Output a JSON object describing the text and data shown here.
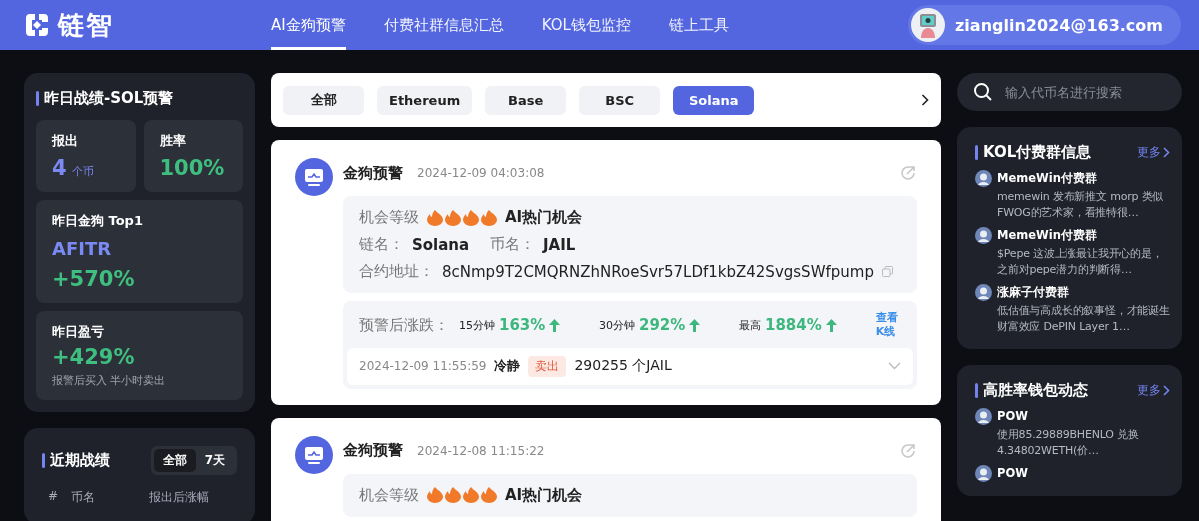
{
  "header": {
    "logo": "链智",
    "nav": [
      {
        "label": "AI金狗预警",
        "selected": true
      },
      {
        "label": "付费社群信息汇总",
        "selected": false
      },
      {
        "label": "KOL钱包监控",
        "selected": false
      },
      {
        "label": "链上工具",
        "selected": false
      }
    ],
    "user": {
      "email": "zianglin2024@163.com"
    }
  },
  "summary": {
    "title": "昨日战绩-SOL预警",
    "reported_label": "报出",
    "reported": "4",
    "reported_unit": "个币",
    "winrate_label": "胜率",
    "winrate": "100%",
    "top_label": "昨日金狗 Top1",
    "top_token": "AFITR",
    "top_gain": "+570%",
    "pnl_label": "昨日盈亏",
    "pnl": "+429%",
    "pnl_note": "报警后买入 半小时卖出"
  },
  "recent": {
    "title": "近期战绩",
    "periods": [
      {
        "label": "全部",
        "selected": true
      },
      {
        "label": "7天",
        "selected": false
      }
    ],
    "columns": [
      "#",
      "币名",
      "报出后涨幅"
    ]
  },
  "filters": [
    {
      "label": "全部",
      "selected": false
    },
    {
      "label": "Ethereum",
      "selected": false
    },
    {
      "label": "Base",
      "selected": false
    },
    {
      "label": "BSC",
      "selected": false
    },
    {
      "label": "Solana",
      "selected": true
    }
  ],
  "alerts": [
    {
      "title": "金狗预警",
      "time": "2024-12-09 04:03:08",
      "level_label": "机会等级",
      "stars": 4,
      "opportunity": "AI热门机会",
      "chain_label": "链名：",
      "chain": "Solana",
      "token_label": "币名：",
      "token": "JAIL",
      "contract_label": "合约地址：",
      "contract": "8cNmp9T2CMQRNZhNRoeSvr57LDf1kbZ42SvgsSWfpump",
      "change_label": "预警后涨跌：",
      "changes": [
        {
          "period": "15分钟",
          "value": "163%"
        },
        {
          "period": "30分钟",
          "value": "292%"
        },
        {
          "period": "最高",
          "value": "1884%"
        }
      ],
      "kline": "查看K线",
      "trade": {
        "time": "2024-12-09 11:55:59",
        "mood": "冷静",
        "action": "卖出",
        "amount": "290255 个JAIL"
      }
    },
    {
      "title": "金狗预警",
      "time": "2024-12-08 11:15:22",
      "level_label": "机会等级",
      "stars": 4,
      "opportunity": "AI热门机会"
    }
  ],
  "search": {
    "placeholder": "输入代币名进行搜索"
  },
  "kol": {
    "title": "KOL付费群信息",
    "more": "更多",
    "items": [
      {
        "name": "MemeWin付费群",
        "text": "memewin 发布新推文 morp 类似FWOG的艺术家，看推特很…"
      },
      {
        "name": "MemeWin付费群",
        "text": "$Pepe 这波上涨最让我开心的是，之前对pepe潜力的判断得…"
      },
      {
        "name": "涨麻子付费群",
        "text": "低估值与高成长的叙事怪，才能诞生财富效应 DePIN Layer 1…"
      }
    ]
  },
  "wallets": {
    "title": "高胜率钱包动态",
    "more": "更多",
    "items": [
      {
        "name": "POW",
        "text": "使用85.29889BHENLO 兑换4.34802WETH(价…"
      },
      {
        "name": "POW"
      }
    ]
  }
}
